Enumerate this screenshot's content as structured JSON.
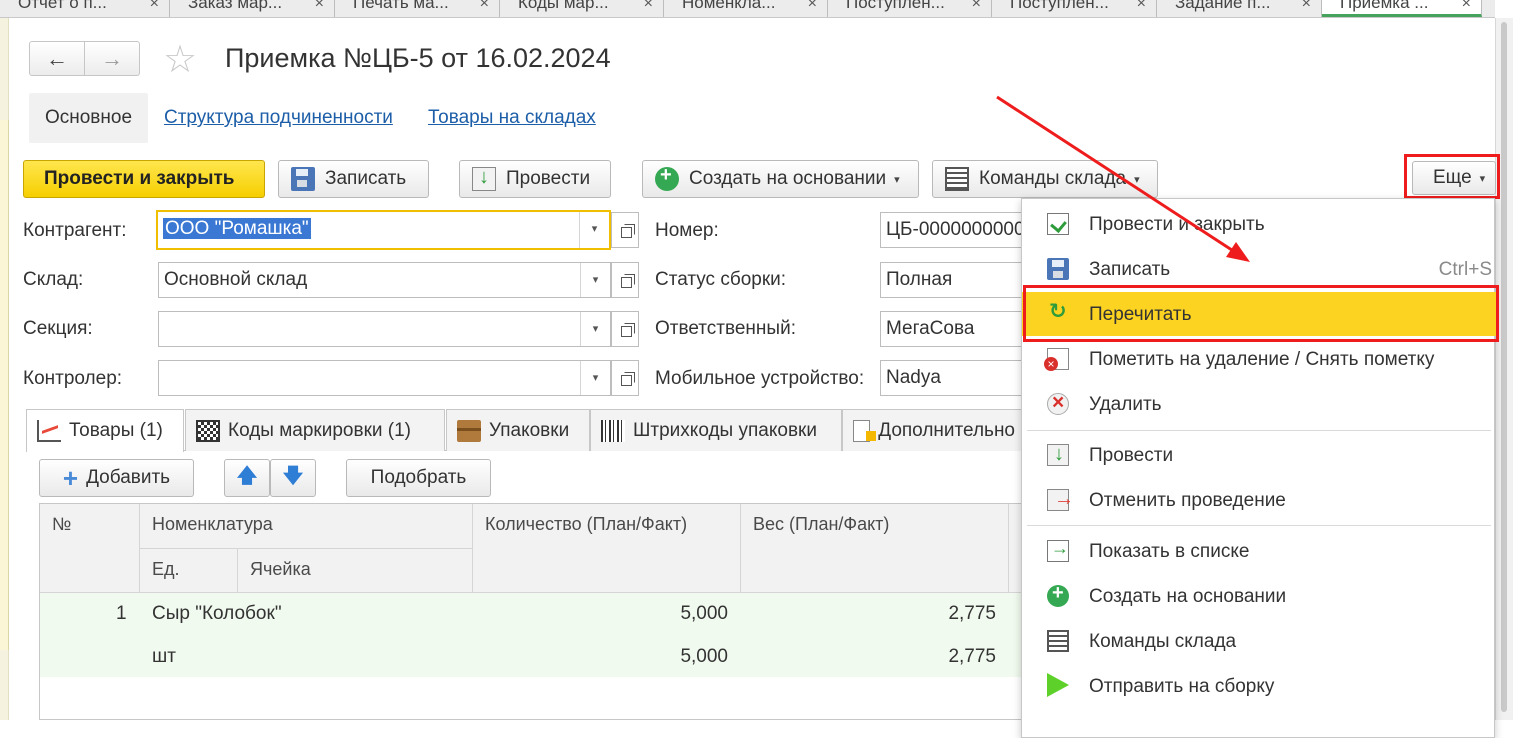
{
  "tabs": [
    {
      "label": "Отчет о п...",
      "close": "×"
    },
    {
      "label": "Заказ мар...",
      "close": "×"
    },
    {
      "label": "Печать ма...",
      "close": "×"
    },
    {
      "label": "Коды мар...",
      "close": "×"
    },
    {
      "label": "Номенкла...",
      "close": "×"
    },
    {
      "label": "Поступлен...",
      "close": "×"
    },
    {
      "label": "Поступлен...",
      "close": "×"
    },
    {
      "label": "Задание п...",
      "close": "×"
    },
    {
      "label": "Приемка ...",
      "close": "×"
    }
  ],
  "header": {
    "back": "←",
    "forward": "→",
    "star": "☆",
    "title": "Приемка №ЦБ-5 от 16.02.2024"
  },
  "subnav": {
    "main": "Основное",
    "structure": "Структура подчиненности",
    "stock": "Товары на складах"
  },
  "toolbar": {
    "post_close": "Провести и закрыть",
    "save": "Записать",
    "post": "Провести",
    "create_based": "Создать на основании",
    "warehouse_cmds": "Команды склада",
    "more": "Еще",
    "caret": "▾"
  },
  "form": {
    "contractor_label": "Контрагент:",
    "contractor_value": "ООО \"Ромашка\"",
    "warehouse_label": "Склад:",
    "warehouse_value": "Основной склад",
    "section_label": "Секция:",
    "section_value": "",
    "controller_label": "Контролер:",
    "controller_value": "",
    "number_label": "Номер:",
    "number_value": "ЦБ-0000000000",
    "status_label": "Статус сборки:",
    "status_value": "Полная",
    "responsible_label": "Ответственный:",
    "responsible_value": "МегаСова",
    "device_label": "Мобильное устройство:",
    "device_value": "Nadya",
    "dd_caret": "▾"
  },
  "page_tabs": {
    "goods": "Товары (1)",
    "codes": "Коды маркировки  (1)",
    "packs": "Упаковки",
    "barcodes": "Штрихкоды упаковки",
    "additional": "Дополнительно"
  },
  "table_toolbar": {
    "add": "Добавить",
    "up": "🡅",
    "down": "🡇",
    "pick": "Подобрать"
  },
  "table": {
    "headers": {
      "num": "№",
      "item": "Номенклатура",
      "unit": "Ед.",
      "cell": "Ячейка",
      "qty": "Количество (План/Факт)",
      "weight": "Вес (План/Факт)"
    },
    "rows": [
      {
        "num": "1",
        "item": "Сыр \"Колобок\"",
        "unit": "шт",
        "qty_plan": "5,000",
        "qty_fact": "5,000",
        "weight_plan": "2,775",
        "weight_fact": "2,775"
      }
    ]
  },
  "menu": {
    "items": [
      {
        "label": "Провести и закрыть",
        "key": "",
        "icon": "post-close-icon"
      },
      {
        "label": "Записать",
        "key": "Ctrl+S",
        "icon": "save-icon"
      },
      {
        "label": "Перечитать",
        "key": "",
        "icon": "refresh-icon"
      },
      {
        "label": "Пометить на удаление / Снять пометку",
        "key": "",
        "icon": "mark-delete-icon"
      },
      {
        "label": "Удалить",
        "key": "",
        "icon": "delete-icon"
      },
      {
        "label": "Провести",
        "key": "",
        "icon": "post-icon"
      },
      {
        "label": "Отменить проведение",
        "key": "",
        "icon": "unpost-icon"
      },
      {
        "label": "Показать в списке",
        "key": "",
        "icon": "show-list-icon"
      },
      {
        "label": "Создать на основании",
        "key": "",
        "icon": "plus-circle-icon"
      },
      {
        "label": "Команды склада",
        "key": "",
        "icon": "warehouse-icon"
      },
      {
        "label": "Отправить на сборку",
        "key": "",
        "icon": "send-icon"
      }
    ]
  },
  "colors": {
    "accent_yellow": "#fdd321",
    "annotation_red": "#ee1c1c",
    "link_blue": "#1d5ea8",
    "active_tab_green": "#46a35e"
  }
}
